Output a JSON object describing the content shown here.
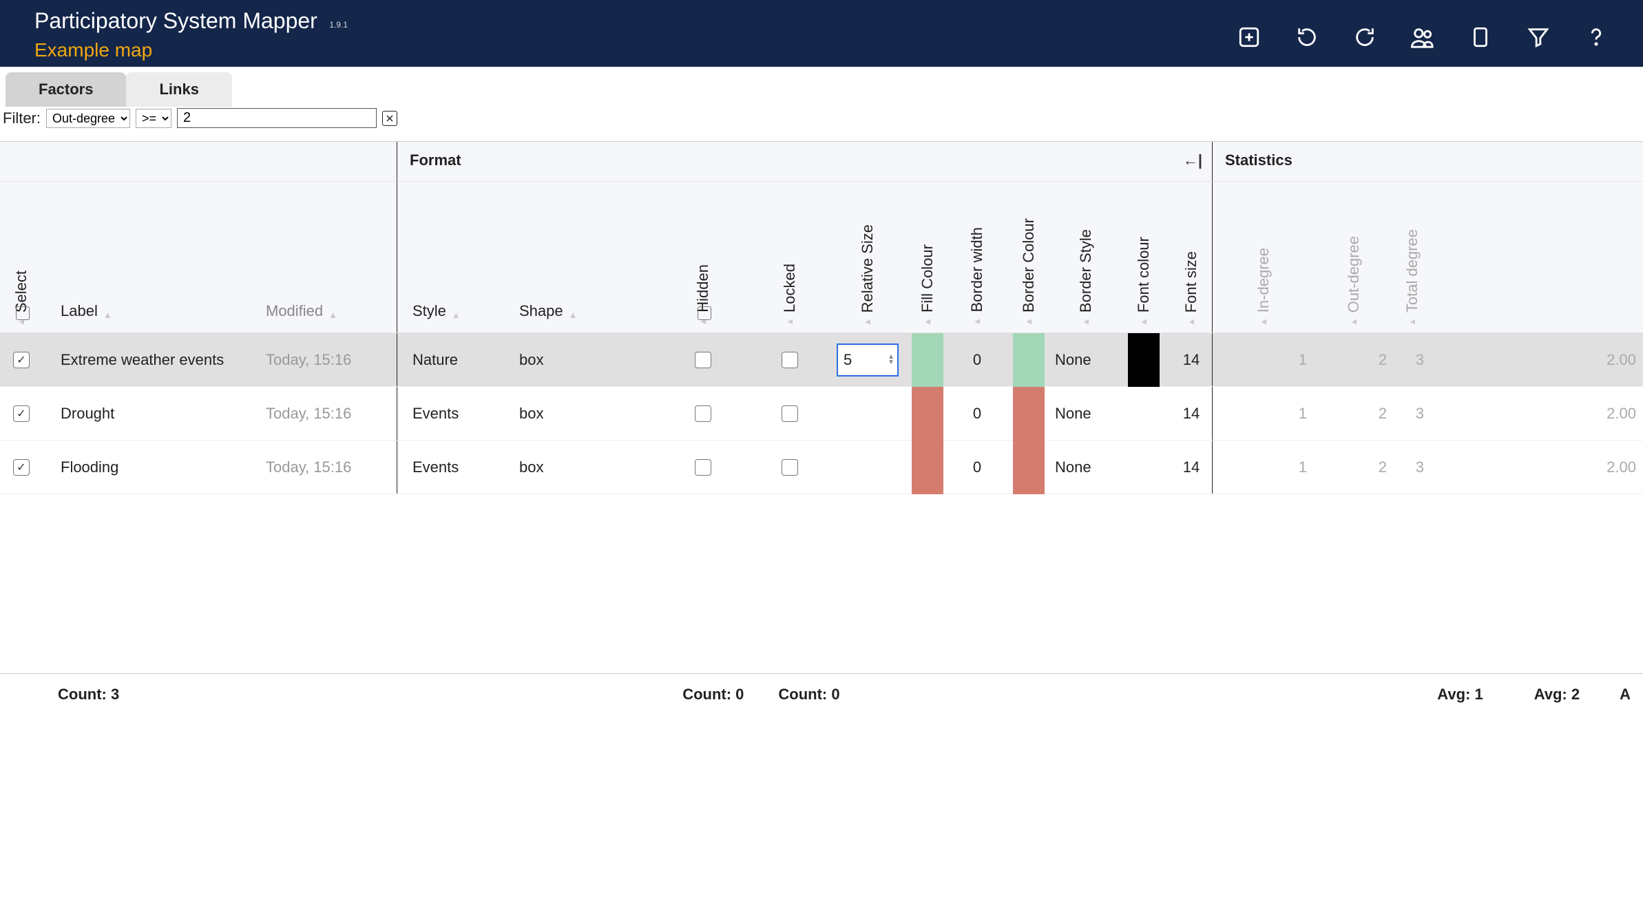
{
  "header": {
    "app_title": "Participatory System Mapper",
    "version": "1.9.1",
    "map_title": "Example map"
  },
  "tabs": {
    "factors": "Factors",
    "links": "Links"
  },
  "filter": {
    "label": "Filter:",
    "attr": "Out-degree",
    "op": ">=",
    "value": "2"
  },
  "sections": {
    "format": "Format",
    "stats": "Statistics"
  },
  "columns": {
    "select": "Select",
    "label": "Label",
    "modified": "Modified",
    "style": "Style",
    "shape": "Shape",
    "hidden": "Hidden",
    "locked": "Locked",
    "relsize": "Relative Size",
    "fill": "Fill Colour",
    "bwidth": "Border width",
    "bcolor": "Border Colour",
    "bstyle": "Border Style",
    "fcolor": "Font colour",
    "fsize": "Font size",
    "indeg": "In-degree",
    "outdeg": "Out-degree",
    "totdeg": "Total degree"
  },
  "rows": [
    {
      "selected": true,
      "label": "Extreme weather events",
      "modified": "Today, 15:16",
      "style": "Nature",
      "shape": "box",
      "hidden": false,
      "locked": false,
      "relsize_editing": "5",
      "fill": "green",
      "bwidth": "0",
      "bcolor": "green",
      "bstyle": "None",
      "fcolor": "black",
      "fsize": "14",
      "indeg": "1",
      "outdeg": "2",
      "totdeg": "3",
      "extra": "2.00",
      "highlight": true
    },
    {
      "selected": true,
      "label": "Drought",
      "modified": "Today, 15:16",
      "style": "Events",
      "shape": "box",
      "hidden": false,
      "locked": false,
      "relsize_editing": "",
      "fill": "red",
      "bwidth": "0",
      "bcolor": "red",
      "bstyle": "None",
      "fcolor": "",
      "fsize": "14",
      "indeg": "1",
      "outdeg": "2",
      "totdeg": "3",
      "extra": "2.00",
      "highlight": false
    },
    {
      "selected": true,
      "label": "Flooding",
      "modified": "Today, 15:16",
      "style": "Events",
      "shape": "box",
      "hidden": false,
      "locked": false,
      "relsize_editing": "",
      "fill": "red",
      "bwidth": "0",
      "bcolor": "red",
      "bstyle": "None",
      "fcolor": "",
      "fsize": "14",
      "indeg": "1",
      "outdeg": "2",
      "totdeg": "3",
      "extra": "2.00",
      "highlight": false
    }
  ],
  "footer": {
    "count_label": "Count: 3",
    "count_hidden": "Count: 0",
    "count_locked": "Count: 0",
    "avg1": "Avg: 1",
    "avg2": "Avg: 2",
    "trail": "A"
  }
}
